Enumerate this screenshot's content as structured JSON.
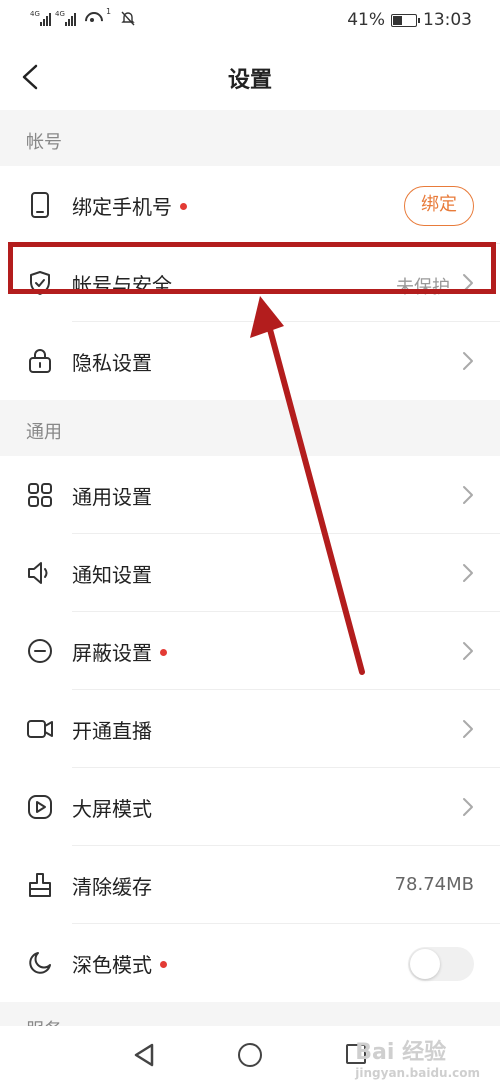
{
  "status_bar": {
    "network1": "4G",
    "network2": "4G",
    "notification_count": "1",
    "battery_percent": "41%",
    "battery_level": 0.41,
    "time": "13:03"
  },
  "header": {
    "title": "设置",
    "back_icon": "chevron-left-icon"
  },
  "sections": {
    "account": "帐号",
    "general": "通用",
    "service": "服务"
  },
  "account_items": [
    {
      "label": "绑定手机号",
      "icon": "phone-icon",
      "has_dot": true,
      "button": "绑定"
    },
    {
      "label": "帐号与安全",
      "icon": "shield-icon",
      "status": "未保护"
    },
    {
      "label": "隐私设置",
      "icon": "lock-icon"
    }
  ],
  "general_items": [
    {
      "label": "通用设置",
      "icon": "grid-icon"
    },
    {
      "label": "通知设置",
      "icon": "speaker-icon"
    },
    {
      "label": "屏蔽设置",
      "icon": "block-icon",
      "has_dot": true
    },
    {
      "label": "开通直播",
      "icon": "video-camera-icon"
    },
    {
      "label": "大屏模式",
      "icon": "play-icon"
    },
    {
      "label": "清除缓存",
      "icon": "brush-icon",
      "value": "78.74MB"
    },
    {
      "label": "深色模式",
      "icon": "moon-icon",
      "has_dot": true,
      "toggle_on": false
    }
  ],
  "watermark": {
    "text": "Bai 经验",
    "sub": "jingyan.baidu.com"
  },
  "colors": {
    "accent": "#e87b3a",
    "dot": "#e33b35",
    "highlight": "#b31d1d",
    "section_bg": "#f5f5f5"
  }
}
